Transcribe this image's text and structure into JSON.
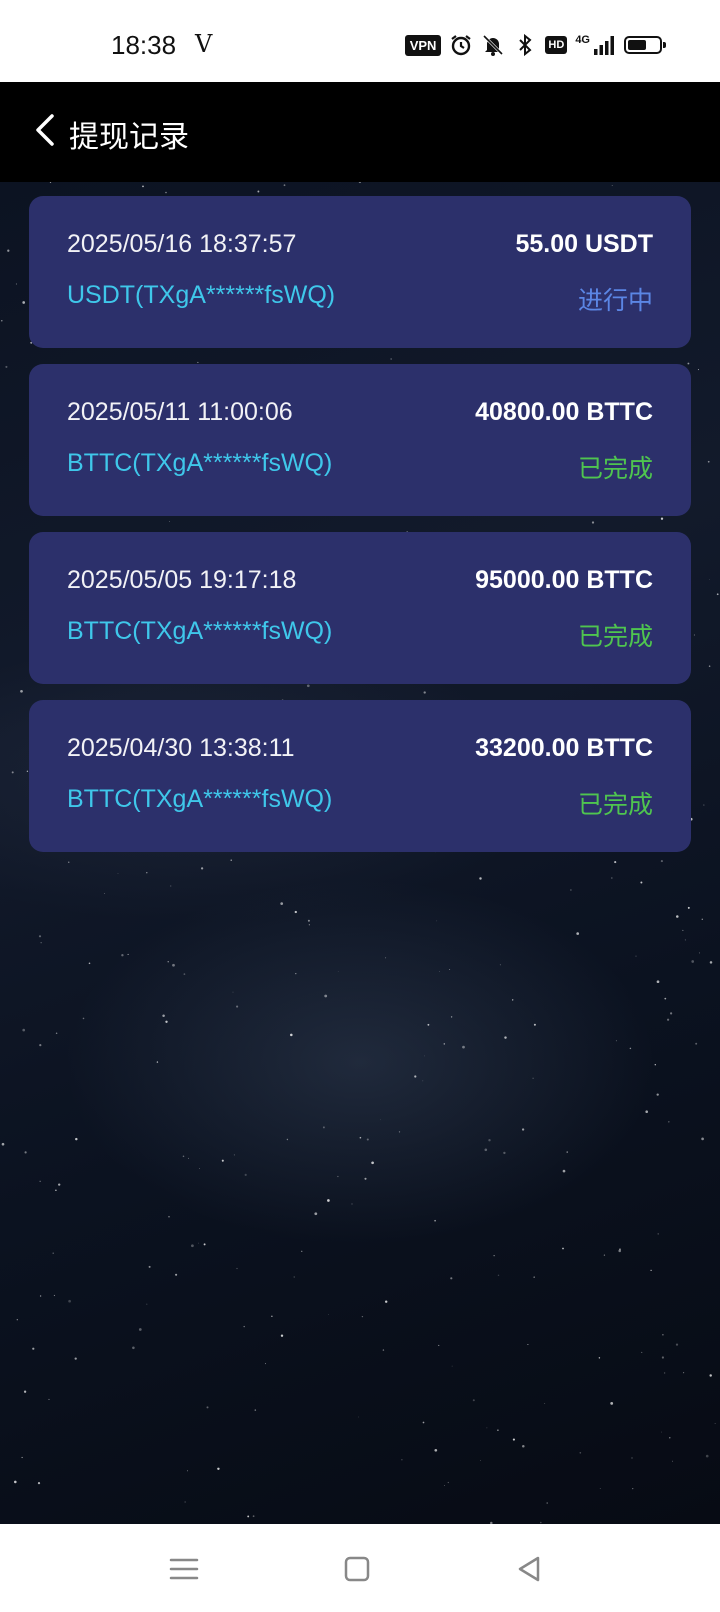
{
  "status_bar": {
    "time": "18:38",
    "carrier": "V",
    "vpn_label": "VPN",
    "hd_label": "HD",
    "network_label": "4G",
    "icons": [
      "alarm-icon",
      "bell-muted-icon",
      "bluetooth-icon",
      "signal-icon",
      "battery-icon"
    ]
  },
  "header": {
    "title": "提现记录",
    "back_icon": "chevron-left-icon"
  },
  "records": [
    {
      "datetime": "2025/05/16 18:37:57",
      "amount": "55.00 USDT",
      "address": "USDT(TXgA******fsWQ)",
      "status": "进行中",
      "status_color": "#5b86e5"
    },
    {
      "datetime": "2025/05/11 11:00:06",
      "amount": "40800.00 BTTC",
      "address": "BTTC(TXgA******fsWQ)",
      "status": "已完成",
      "status_color": "#4fc54f"
    },
    {
      "datetime": "2025/05/05 19:17:18",
      "amount": "95000.00 BTTC",
      "address": "BTTC(TXgA******fsWQ)",
      "status": "已完成",
      "status_color": "#4fc54f"
    },
    {
      "datetime": "2025/04/30 13:38:11",
      "amount": "33200.00 BTTC",
      "address": "BTTC(TXgA******fsWQ)",
      "status": "已完成",
      "status_color": "#4fc54f"
    }
  ],
  "colors": {
    "card_background": "#2c306b",
    "address_text": "#3fc7ea",
    "header_background": "#000000"
  },
  "nav_bar": {
    "icons": [
      "menu-icon",
      "home-square-icon",
      "back-triangle-icon"
    ]
  }
}
